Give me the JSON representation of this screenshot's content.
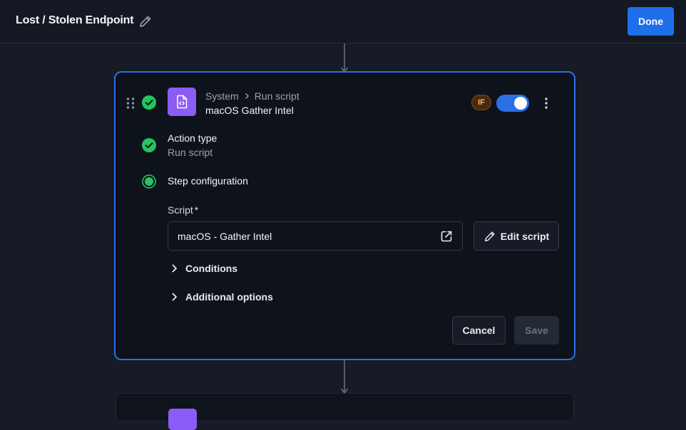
{
  "header": {
    "title": "Lost / Stolen Endpoint",
    "done_label": "Done"
  },
  "step": {
    "breadcrumb": [
      "System",
      "Run script"
    ],
    "name": "macOS Gather Intel",
    "condition_badge": "IF",
    "enabled": true,
    "icon": "script-file-icon"
  },
  "action_type": {
    "label": "Action type",
    "value": "Run script"
  },
  "configuration": {
    "label": "Step configuration",
    "script_label": "Script",
    "required_mark": "*",
    "script_value": "macOS - Gather Intel",
    "edit_script_label": "Edit script",
    "conditions_label": "Conditions",
    "additional_options_label": "Additional options"
  },
  "footer": {
    "cancel_label": "Cancel",
    "save_label": "Save"
  },
  "colors": {
    "accent": "#2b6fe6",
    "success": "#22c55e",
    "script_icon_bg": "#8b5cf6",
    "if_badge_bg": "#4a2a0c"
  }
}
